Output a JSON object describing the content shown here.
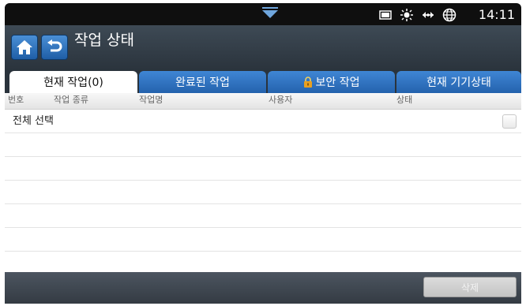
{
  "status_bar": {
    "time": "14:11",
    "icons": [
      "monitor-icon",
      "brightness-icon",
      "network-icon",
      "globe-icon"
    ]
  },
  "header": {
    "title": "작업 상태",
    "home_icon": "home-icon",
    "back_icon": "back-icon"
  },
  "tabs": [
    {
      "label": "현재 작업(0)",
      "active": true
    },
    {
      "label": "완료된 작업",
      "active": false
    },
    {
      "label": "보안 작업",
      "active": false,
      "icon": "lock-icon"
    },
    {
      "label": "현재 기기상태",
      "active": false
    }
  ],
  "columns": [
    "번호",
    "작업 종류",
    "작업명",
    "사용자",
    "상태"
  ],
  "list": {
    "select_all_label": "전체 선택",
    "checked": false
  },
  "footer": {
    "delete_label": "삭제",
    "delete_enabled": false
  },
  "colors": {
    "tab_blue": "#2f74c4",
    "header_dark": "#2a333c"
  }
}
